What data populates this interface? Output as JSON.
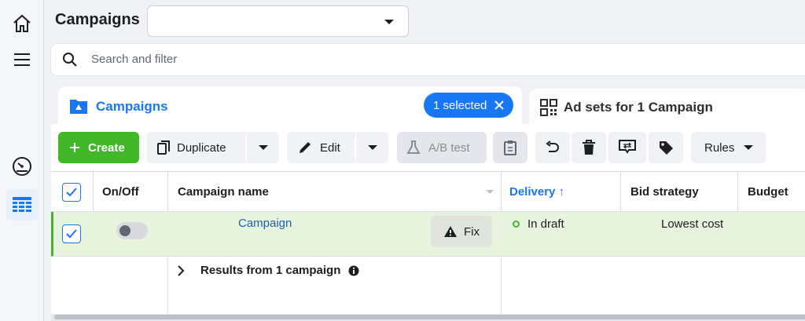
{
  "header": {
    "title": "Campaigns",
    "select_value": ""
  },
  "search": {
    "placeholder": "Search and filter"
  },
  "tabs": {
    "campaigns_label": "Campaigns",
    "selected_badge": "1 selected",
    "adsets_label": "Ad sets for 1 Campaign"
  },
  "toolbar": {
    "create": "Create",
    "duplicate": "Duplicate",
    "edit": "Edit",
    "ab_test": "A/B test",
    "rules": "Rules"
  },
  "table": {
    "columns": [
      "On/Off",
      "Campaign name",
      "Delivery ↑",
      "Bid strategy",
      "Budget"
    ],
    "row": {
      "name": "Campaign",
      "fix_label": "Fix",
      "delivery": "In draft",
      "bid": "Lowest cost",
      "toggle_on": false,
      "checked": true
    },
    "results_label": "Results from 1 campaign"
  },
  "colors": {
    "accent": "#1877f2",
    "create": "#42b72a",
    "row_highlight": "#e6f4dd"
  }
}
